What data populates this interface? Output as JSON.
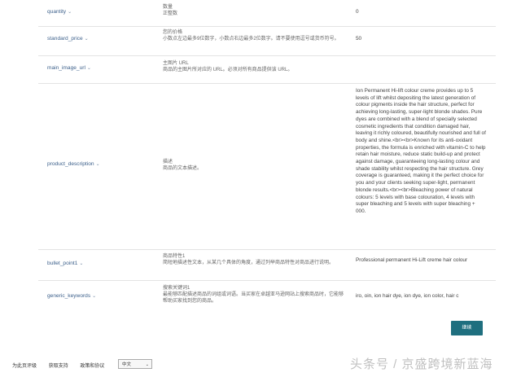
{
  "rows": [
    {
      "name": "quantity",
      "desc": "数量\n正整数",
      "value": "0"
    },
    {
      "name": "standard_price",
      "desc": "您的价格\n小数点左边最多9位数字，小数点右边最多2位数字。请不要使用逗号或货币符号。",
      "value": "50"
    },
    {
      "name": "main_image_url",
      "desc": "主图片 URL\n商品的主图片所对应的 URL。必须对所有商品提供该 URL。",
      "value": ""
    },
    {
      "name": "product_description",
      "desc": "描述\n商品的文本描述。",
      "value": "Ion Permanent Hi-lift colour creme provides up to 5 levels of lift whilst depositing the latest generation of colour pigments inside the hair structure, perfect for achieving long-lasting, super-light blonde shades. Pure dyes are combined with a blend of specially selected cosmetic ingredients that condition damaged hair, leaving it richly coloured, beautifully nourished and full of body and shine.<br><br>Known for its anti-oxidant properties, the formula is enriched with vitamin-C to help retain hair moisture, reduce static build-up and protect against damage, guaranteeing long-lasting colour and shade stability whilst respecting the hair structure. Grey coverage is guaranteed, making it the perfect choice for you and your clients seeking super-light, permanent blonde results.<br><br>Bleaching power of natural colours: 5 levels with base colouration, 4 levels with super bleaching and 5 levels with super bleaching + 000."
    },
    {
      "name": "bullet_point1",
      "desc": "商品特性1\n简短地描述性文本，从某几个具体的角度，通过列举商品特性对商品进行说明。",
      "value": "Professional permanent Hi-Lift creme hair colour"
    },
    {
      "name": "generic_keywords",
      "desc": "搜索关键词1\n最能够匹配描述商品的词组或词语。当买家在卓越亚马逊网站上搜索商品时，它能够帮助买家找到您的商品。",
      "value": "iro, oin, ion hair dye, ion dye, ion color, hair c"
    }
  ],
  "continue_label": "继续",
  "footer": {
    "feedback": "为此页评级",
    "support": "获取支持",
    "policy": "政策和协议",
    "language": "中文"
  },
  "watermark": "头条号 / 京盛跨境新蓝海",
  "chevron": "⌄"
}
